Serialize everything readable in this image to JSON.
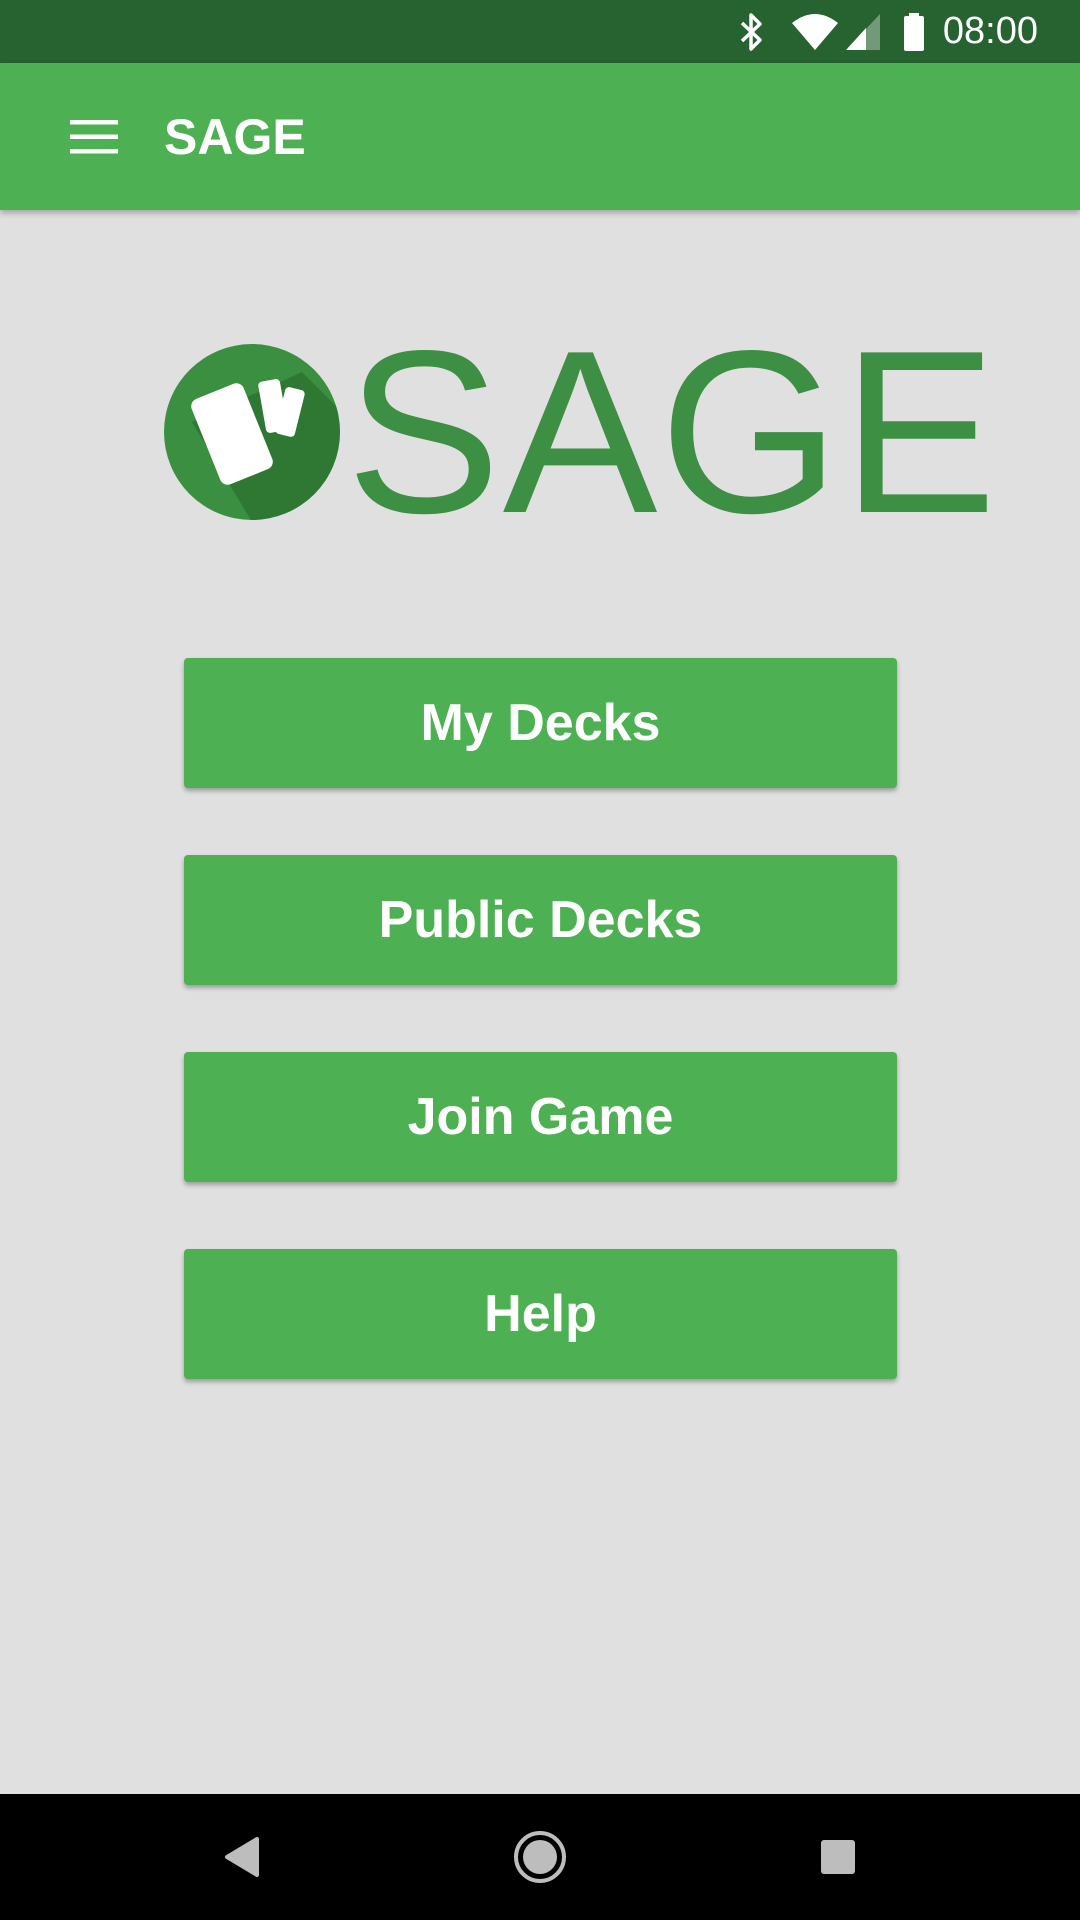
{
  "status_bar": {
    "time": "08:00",
    "icons": [
      "bluetooth-icon",
      "wifi-icon",
      "cell-signal-icon",
      "battery-icon"
    ],
    "background": "#276330"
  },
  "app_bar": {
    "title": "SAGE",
    "menu_icon": "hamburger-menu-icon",
    "background": "#4db052"
  },
  "logo": {
    "text": "SAGE",
    "icon": "cards-logo-icon",
    "color": "#3c8f43"
  },
  "menu": {
    "buttons": [
      {
        "label": "My Decks"
      },
      {
        "label": "Public Decks"
      },
      {
        "label": "Join Game"
      },
      {
        "label": "Help"
      }
    ]
  },
  "nav_bar": {
    "icons": [
      "back-icon",
      "home-icon",
      "recents-icon"
    ]
  }
}
